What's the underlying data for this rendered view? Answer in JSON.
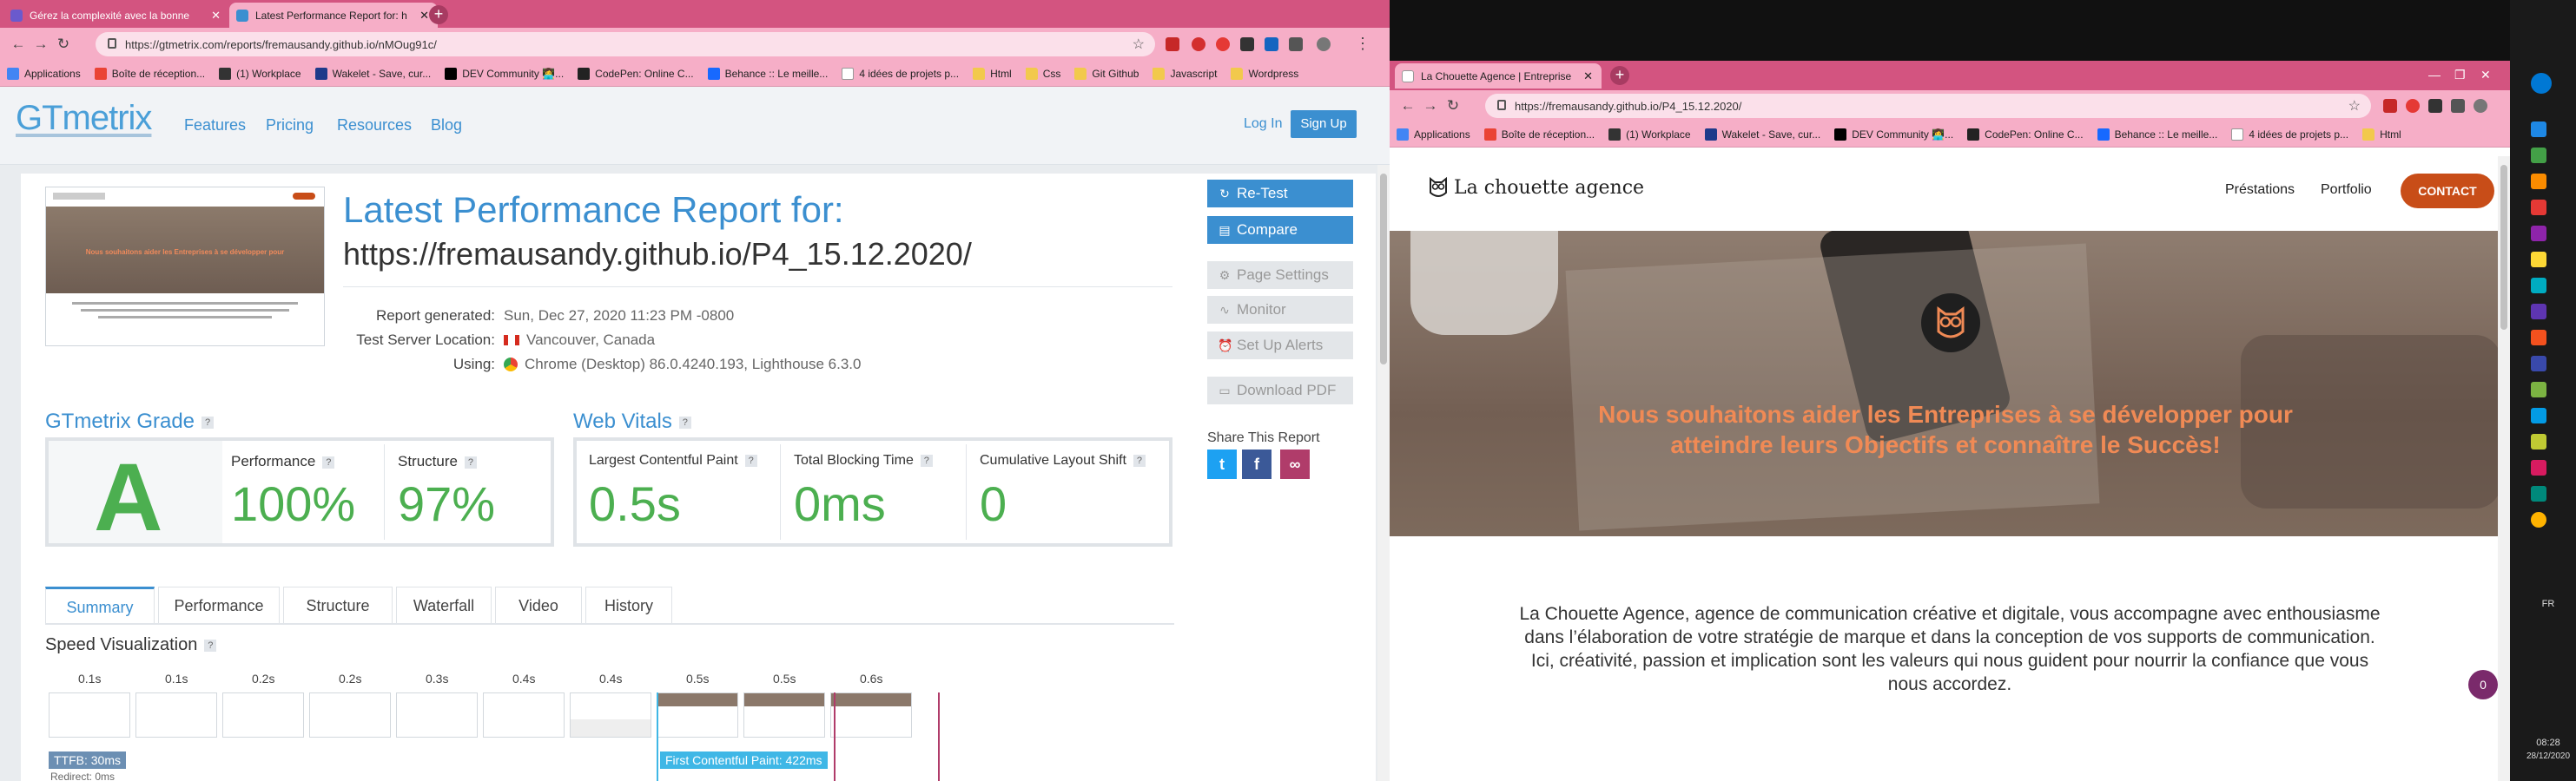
{
  "left_browser": {
    "tabs": [
      {
        "title": "Gérez la complexité avec la bonne",
        "active": false
      },
      {
        "title": "Latest Performance Report for: h",
        "active": true
      }
    ],
    "url": "https://gtmetrix.com/reports/fremausandy.github.io/nMOug91c/",
    "bookmarks": [
      "Applications",
      "Boîte de réception...",
      "(1) Workplace",
      "Wakelet - Save, cur...",
      "DEV Community 👩‍💻...",
      "CodePen: Online C...",
      "Behance :: Le meille...",
      "4 idées de projets p...",
      "Html",
      "Css",
      "Git Github",
      "Javascript",
      "Wordpress"
    ]
  },
  "gtmetrix": {
    "logo": "GTmetrix",
    "nav": [
      "Features",
      "Pricing",
      "Resources",
      "Blog"
    ],
    "login": "Log In",
    "signup": "Sign Up",
    "report_title": "Latest Performance Report for:",
    "report_url": "https://fremausandy.github.io/P4_15.12.2020/",
    "meta": [
      {
        "label": "Report generated:",
        "value": "Sun, Dec 27, 2020 11:23 PM -0800"
      },
      {
        "label": "Test Server Location:",
        "value": "Vancouver, Canada"
      },
      {
        "label": "Using:",
        "value": "Chrome (Desktop) 86.0.4240.193, Lighthouse 6.3.0"
      }
    ],
    "side_buttons": [
      "Re-Test",
      "Compare",
      "Page Settings",
      "Monitor",
      "Set Up Alerts",
      "Download PDF"
    ],
    "share_label": "Share This Report",
    "grade_title": "GTmetrix Grade",
    "grade": "A",
    "performance_label": "Performance",
    "performance_value": "100%",
    "structure_label": "Structure",
    "structure_value": "97%",
    "vitals_title": "Web Vitals",
    "lcp_label": "Largest Contentful Paint",
    "lcp_value": "0.5s",
    "tbt_label": "Total Blocking Time",
    "tbt_value": "0ms",
    "cls_label": "Cumulative Layout Shift",
    "cls_value": "0",
    "tabs": [
      "Summary",
      "Performance",
      "Structure",
      "Waterfall",
      "Video",
      "History"
    ],
    "speed_title": "Speed Visualization",
    "frame_times": [
      "0.1s",
      "0.1s",
      "0.2s",
      "0.2s",
      "0.3s",
      "0.4s",
      "0.4s",
      "0.5s",
      "0.5s",
      "0.6s"
    ],
    "ttfb": "TTFB: 30ms",
    "redirect": "Redirect: 0ms",
    "fcp": "First Contentful Paint: 422ms"
  },
  "right_browser": {
    "tab_title": "La Chouette Agence | Entreprise",
    "url": "https://fremausandy.github.io/P4_15.12.2020/",
    "bookmarks": [
      "Applications",
      "Boîte de réception...",
      "(1) Workplace",
      "Wakelet - Save, cur...",
      "DEV Community 👩‍💻...",
      "CodePen: Online C...",
      "Behance :: Le meille...",
      "4 idées de projets p...",
      "Html"
    ]
  },
  "site": {
    "logo": "La chouette agence",
    "nav": [
      "Préstations",
      "Portfolio"
    ],
    "contact": "CONTACT",
    "hero_line1": "Nous souhaitons aider les Entreprises à se développer pour",
    "hero_line2": "atteindre leurs Objectifs et connaître le Succès!",
    "intro": "La Chouette Agence, agence de communication créative et digitale, vous accompagne avec enthousiasme dans l’élaboration de votre stratégie de marque et dans la conception de vos supports de communication. Ici, créativité, passion et implication sont les valeurs qui nous guident pour nourrir la confiance que vous nous accordez.",
    "badge": "0"
  },
  "taskbar": {
    "lang": "FR",
    "time": "08:28",
    "date": "28/12/2020"
  },
  "colors": {
    "chrome_pink": "#d35480",
    "gtmetrix_blue": "#3b8fd0",
    "grade_green": "#4caf50",
    "contact_orange": "#c84d18",
    "hero_text": "#f08a55"
  }
}
